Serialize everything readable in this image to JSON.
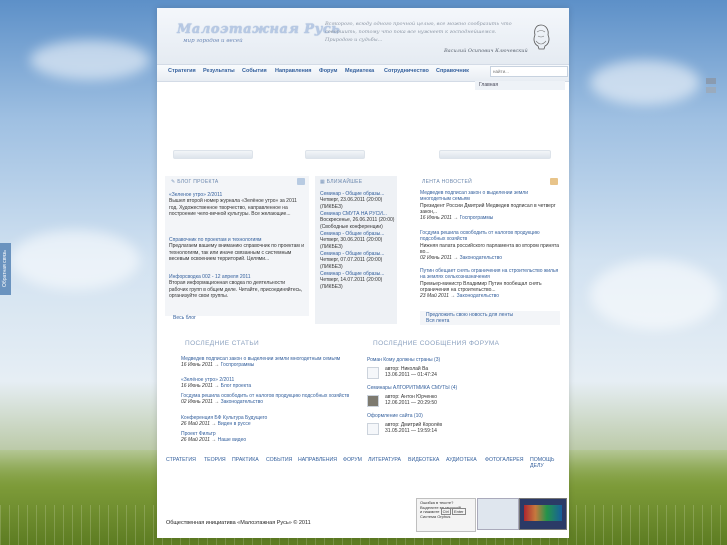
{
  "side_tab": "Обратная связь",
  "header": {
    "logo_title": "Малоэтажная Русь",
    "logo_subtitle": "мир городов и весей",
    "quote": "Всякорого, всюду одного прочной целью, все можно сообразить что совершить, потому что пока все нужнеет к господнейшемся. Природою и судьбы...",
    "quote_author": "Василий Осипович Ключевский"
  },
  "nav": {
    "items": [
      "Стратегия",
      "Результаты",
      "События",
      "Направления",
      "Форум",
      "Медиатека",
      "Сотрудничество",
      "Справочник"
    ],
    "search_placeholder": "найти..."
  },
  "breadcrumb": "Главная",
  "blog": {
    "title": "БЛОГ ПРОЕКТА",
    "posts": [
      {
        "title": "«Зеленое утро» 2/2011",
        "text": "Вышел второй номер журнала «Зелёное утро» за 2011 год. Художественное творчество, направленное на построение чело-вечной культуры. Все желающие..."
      },
      {
        "title": "Справочник по проектам и технологиям",
        "text": "Предлагаем вашему вниманию справочник по проектам и технологиям, так или иначе связанным с системным весевым освоением территорий. Целями..."
      },
      {
        "title": "Инфорсводка 002 - 12 апреля 2011",
        "text": "Вторая информационная сводка по деятельности рабочих групп в общем деле. Читайте, присоединяйтесь, организуйте свои группы."
      }
    ],
    "all_link": "Весь блог"
  },
  "upcoming": {
    "title": "БЛИЖАЙШЕЕ",
    "events": [
      {
        "title": "Семинар - Общие образы...",
        "when": "Четверг, 23.06.2011 (20:00)",
        "where": "(ЛИКБЕЗ)"
      },
      {
        "title": "Семинар СМУТА НА РУСИ...",
        "when": "Воскресенье, 26.06.2011 (20:00)",
        "where": "(Свободные конференции)"
      },
      {
        "title": "Семинар - Общие образы...",
        "when": "Четверг, 30.06.2011 (20:00)",
        "where": "(ЛИКБЕЗ)"
      },
      {
        "title": "Семинар - Общие образы...",
        "when": "Четверг, 07.07.2011 (20:00)",
        "where": "(ЛИКБЕЗ)"
      },
      {
        "title": "Семинар - Общие образы...",
        "when": "Четверг, 14.07.2011 (20:00)",
        "where": "(ЛИКБЕЗ)"
      }
    ]
  },
  "newsfeed": {
    "title": "ЛЕНТА НОВОСТЕЙ",
    "items": [
      {
        "title": "Медведев подписал закон о выделении земли многодетным семьям",
        "text": "Президент России Дмитрий Медведев подписал в четверг закон,..",
        "date": "16 Июнь 2011",
        "tag": "Госпрограммы"
      },
      {
        "title": "Госдума решила освободить от налогов продукцию подсобных хозяйств",
        "text": "Нижняя палата российского парламента во втором принята во...",
        "date": "02 Июнь 2011",
        "tag": "Законодательство"
      },
      {
        "title": "Путин обещает снять ограничения на строительство жилья на землях сельхозназначения",
        "text": "Премьер-министр Владимир Путин пообещал снять ограничения на строительство...",
        "date": "23 Май 2011",
        "tag": "Законодательство"
      }
    ],
    "suggest_link": "Предложить свою новость для ленты",
    "all_link": "Вся лента"
  },
  "latest_articles": {
    "title": "ПОСЛЕДНИЕ СТАТЬИ",
    "items": [
      {
        "title": "Медведев подписал закон о выделении земли многодетным семьям",
        "date": "16 Июнь 2011",
        "tag": "Госпрограммы"
      },
      {
        "title": "«Зелёное утро» 2/2011",
        "date": "16 Июнь 2011",
        "tag": "Блог проекта"
      },
      {
        "title": "Госдума решила освободить от налогов продукцию подсобных хозяйств",
        "date": "02 Июнь 2011",
        "tag": "Законодательство"
      },
      {
        "title": "Конференция БФ Культура Будущего",
        "date": "26 Май 2011",
        "tag": "Виден в руссе"
      },
      {
        "title": "Проект Фильтр",
        "date": "26 Май 2011",
        "tag": "Наше видео"
      }
    ]
  },
  "forum": {
    "title": "ПОСЛЕДНИЕ СООБЩЕНИЯ ФОРУМА",
    "topics": [
      {
        "title": "Роман Кому должны страны (3)",
        "author": "автор: Николай Ва",
        "date": "13.06.2011 — 01:47:24"
      },
      {
        "title": "Семинары АЛГОРИТМИКА СМУТЫ (4)",
        "author": "автор: Антон Юрченко",
        "date": "12.06.2011 — 20:29:50"
      },
      {
        "title": "Оформление сайта (10)",
        "author": "автор: Дмитрий Королёв",
        "date": "31.05.2011 — 19:59:14"
      }
    ]
  },
  "footer": {
    "nav": [
      "СТРАТЕГИЯ",
      "ТЕОРИЯ",
      "ПРАКТИКА",
      "СОБЫТИЯ",
      "НАПРАВЛЕНИЯ",
      "ФОРУМ",
      "ЛИТЕРАТУРА",
      "ВИДЕОТЕКА",
      "АУДИОТЕКА",
      "ФОТОГАЛЕРЕЯ",
      "ПОМОЩЬ ДЕЛУ"
    ],
    "copyright": "Общественная инициатива «Малоэтажная Русь» © 2011",
    "error_widget": {
      "line1": "Ошибка в тексте?",
      "line2": "Выделите ее мышкой!",
      "line3": "и нажмите",
      "key1": "Ctrl",
      "key2": "Enter",
      "system": "Система Orphus"
    }
  },
  "colors": {
    "link": "#34609d",
    "sky": "#9fc0e2",
    "field": "#6f8d2e"
  }
}
